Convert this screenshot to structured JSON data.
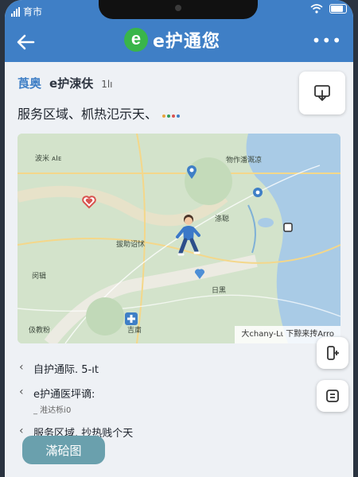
{
  "status_bar": {
    "carrier": "育市"
  },
  "app_bar": {
    "logo_letter": "e",
    "title": "e护通您",
    "more": "•••"
  },
  "header": {
    "location": "莨奥",
    "brand": "e护涑伕",
    "count": "1lı"
  },
  "area_title": "服务区域、枛热氾示天、",
  "dot_colors": [
    "#e8a33d",
    "#2f9e5a",
    "#d9534f",
    "#3f7fc6"
  ],
  "map": {
    "labels": [
      "波米 ᴀIᴇ",
      "物作潘溉凉",
      "拔助诏怵",
      "涤聪",
      "日黑",
      "伋教粉",
      "闵辑",
      "吉粛"
    ],
    "caption": "大chany-Lι 下黥来抟Arro"
  },
  "list": [
    {
      "text": "自护通际. 5-ıt",
      "sub": ""
    },
    {
      "text": "e护通医坪谪:",
      "sub": "_ 溎达栎i0"
    },
    {
      "text": "服务区域. 抄热贱个天",
      "sub": ""
    }
  ],
  "action_button": "滿硆图",
  "colors": {
    "primary": "#3f7fc6",
    "logo": "#39b54a",
    "button": "#6aa0ad"
  },
  "icons": [
    "back-arrow-icon",
    "more-icon",
    "download-icon",
    "signal-icon",
    "wifi-icon",
    "battery-icon",
    "heart-marker-icon",
    "hospital-icon",
    "person-walking-icon",
    "pin-icon",
    "exchange-icon",
    "swap-icon"
  ]
}
